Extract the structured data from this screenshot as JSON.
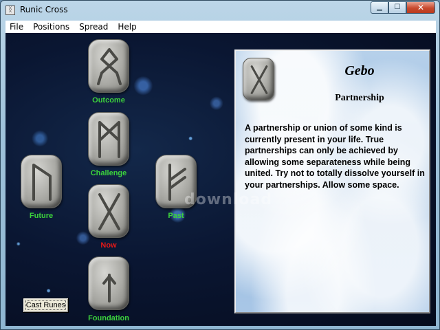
{
  "window": {
    "title": "Runic Cross"
  },
  "menu": [
    "File",
    "Positions",
    "Spread",
    "Help"
  ],
  "positions": {
    "outcome": {
      "label": "Outcome",
      "rune": "othala"
    },
    "challenge": {
      "label": "Challenge",
      "rune": "mannaz"
    },
    "future": {
      "label": "Future",
      "rune": "uruz"
    },
    "past": {
      "label": "Past",
      "rune": "fehu"
    },
    "now": {
      "label": "Now",
      "rune": "gebo"
    },
    "foundation": {
      "label": "Foundation",
      "rune": "tiwaz"
    }
  },
  "cast_button": "Cast Runes",
  "reading": {
    "rune_name": "Gebo",
    "meaning": "Partnership",
    "text": "A partnership or union of some kind is currently present in your life.  True partnerships can only be achieved by allowing some separateness while being united.  Try not to totally dissolve yourself in your partnerships.  Allow some space."
  },
  "watermark": "download",
  "colors": {
    "label_green": "#3cd23c",
    "label_now": "#e01818"
  },
  "caption_buttons": {
    "minimize": "minimize-icon",
    "maximize": "maximize-icon",
    "close": "close-icon"
  }
}
